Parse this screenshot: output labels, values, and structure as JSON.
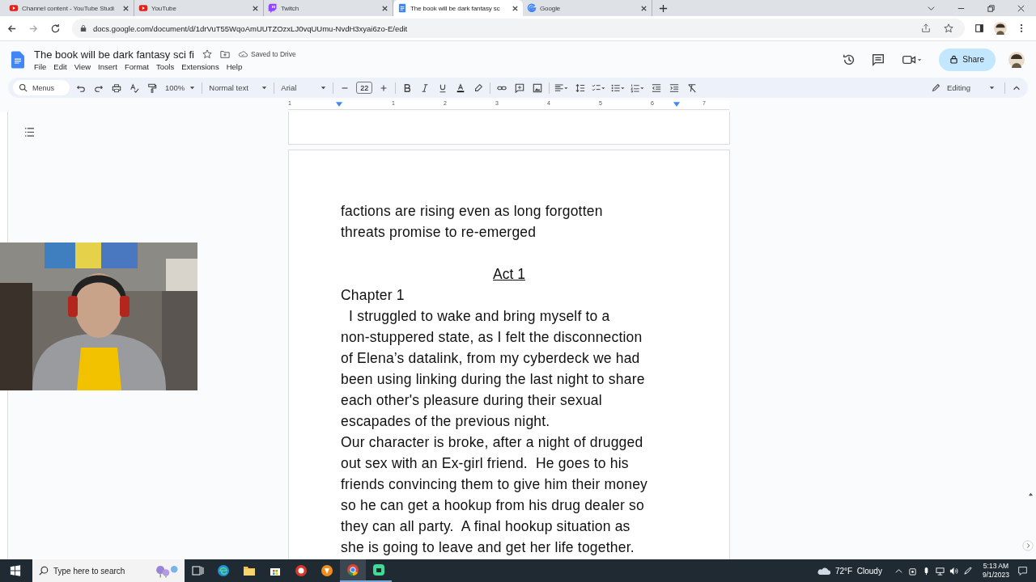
{
  "browser": {
    "tabs": [
      {
        "title": "Channel content - YouTube Studi",
        "kind": "studio",
        "selected": false
      },
      {
        "title": "YouTube",
        "kind": "youtube",
        "selected": false
      },
      {
        "title": "Twitch",
        "kind": "twitch",
        "selected": false
      },
      {
        "title": "The book will be dark fantasy sc",
        "kind": "docs",
        "selected": true
      },
      {
        "title": "Google",
        "kind": "google",
        "selected": false
      }
    ],
    "address": "docs.google.com/document/d/1drVuT55WqoAmUUTZOzxLJ0vqUUmu-NvdH3xyai6zo-E/edit"
  },
  "docs": {
    "title": "The book will be dark fantasy sci fi",
    "save_status": "Saved to Drive",
    "menus": [
      "File",
      "Edit",
      "View",
      "Insert",
      "Format",
      "Tools",
      "Extensions",
      "Help"
    ],
    "share": "Share",
    "toolbar": {
      "search_placeholder": "Menus",
      "zoom": "100%",
      "style": "Normal text",
      "font": "Arial",
      "font_size": "22",
      "mode": "Editing"
    },
    "ruler": [
      "1",
      "1",
      "2",
      "3",
      "4",
      "5",
      "6",
      "7"
    ]
  },
  "document": {
    "blocks": [
      {
        "kind": "text",
        "lines": [
          "factions are rising even as long forgotten",
          "threats promise to re-emerged"
        ]
      },
      {
        "kind": "blank"
      },
      {
        "kind": "heading",
        "lines": [
          "Act 1"
        ]
      },
      {
        "kind": "text",
        "lines": [
          "Chapter 1",
          "  I struggled to wake and bring myself to a",
          "non-stuppered state, as I felt the disconnection",
          "of Elena’s datalink, from my cyberdeck we had",
          "been using linking during the last night to share",
          "each other's pleasure during their sexual",
          "escapades of the previous night.",
          "Our character is broke, after a night of drugged",
          "out sex with an Ex-girl friend.  He goes to his",
          "friends convincing them to give him their money",
          "so he can get a hookup from his drug dealer so",
          "they can all party.  A final hookup situation as",
          "she is going to leave and get her life together."
        ]
      }
    ]
  },
  "taskbar": {
    "search_placeholder": "Type here to search",
    "weather": "72°F  Cloudy",
    "time": "5:13 AM",
    "date": "9/1/2023"
  }
}
